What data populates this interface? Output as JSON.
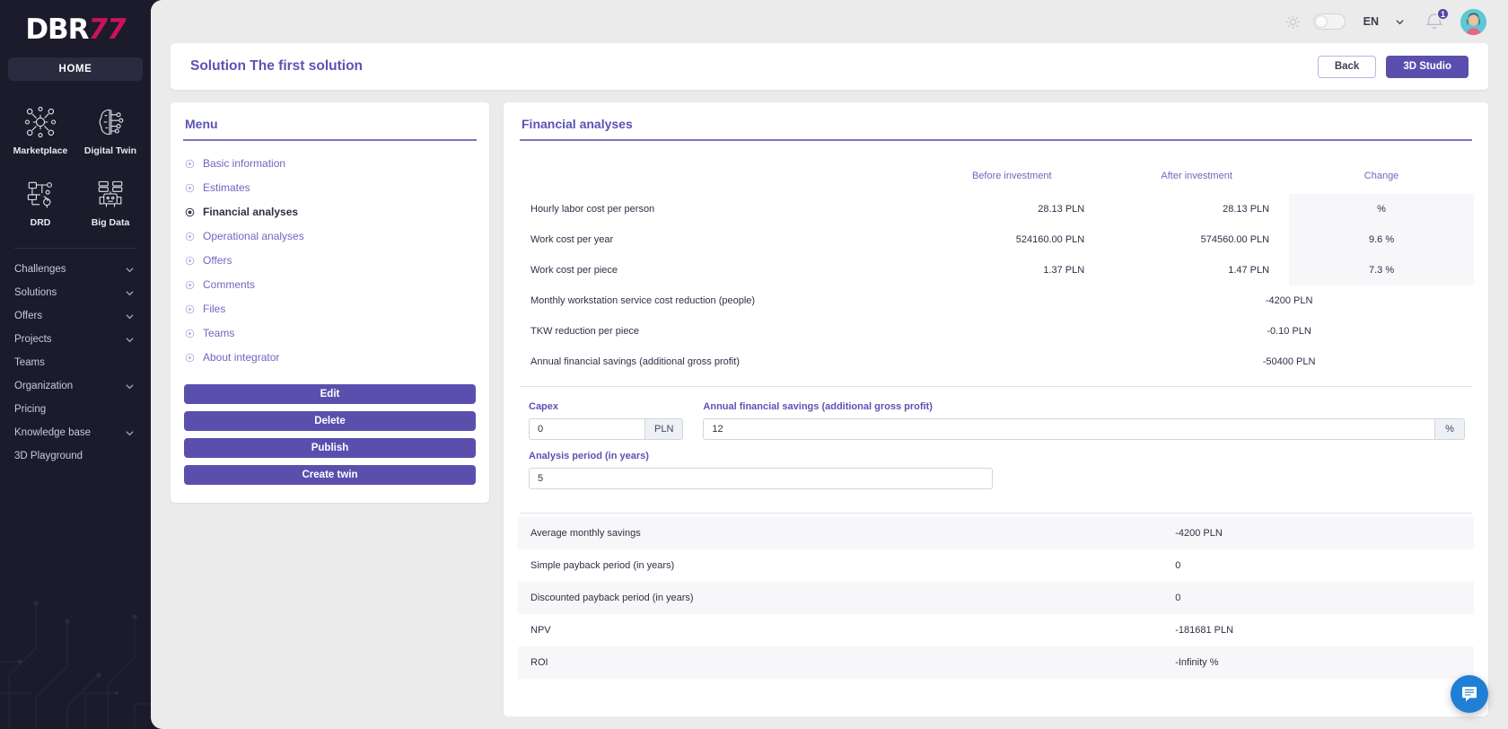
{
  "brand": {
    "logo_white": "DBR",
    "logo_red": "77"
  },
  "sidebar": {
    "home_label": "HOME",
    "tiles": [
      {
        "label": "Marketplace",
        "icon": "marketplace-network-icon"
      },
      {
        "label": "Digital Twin",
        "icon": "brain-circuit-icon"
      },
      {
        "label": "DRD",
        "icon": "drd-flow-icon"
      },
      {
        "label": "Big Data",
        "icon": "big-data-server-icon"
      }
    ],
    "nav": [
      {
        "label": "Challenges",
        "expandable": true
      },
      {
        "label": "Solutions",
        "expandable": true
      },
      {
        "label": "Offers",
        "expandable": true
      },
      {
        "label": "Projects",
        "expandable": true
      },
      {
        "label": "Teams",
        "expandable": false
      },
      {
        "label": "Organization",
        "expandable": true
      },
      {
        "label": "Pricing",
        "expandable": false
      },
      {
        "label": "Knowledge base",
        "expandable": true
      },
      {
        "label": "3D Playground",
        "expandable": false
      }
    ]
  },
  "topbar": {
    "theme_icon": "sun-icon",
    "theme_toggle": "theme-toggle",
    "language": "EN",
    "notifications_count": "1",
    "avatar": "user-avatar"
  },
  "page": {
    "title": "Solution The first solution",
    "back_label": "Back",
    "studio_label": "3D Studio"
  },
  "menu": {
    "title": "Menu",
    "items": [
      {
        "label": "Basic information",
        "active": false
      },
      {
        "label": "Estimates",
        "active": false
      },
      {
        "label": "Financial analyses",
        "active": true
      },
      {
        "label": "Operational analyses",
        "active": false
      },
      {
        "label": "Offers",
        "active": false
      },
      {
        "label": "Comments",
        "active": false
      },
      {
        "label": "Files",
        "active": false
      },
      {
        "label": "Teams",
        "active": false
      },
      {
        "label": "About integrator",
        "active": false
      }
    ],
    "buttons": [
      {
        "label": "Edit"
      },
      {
        "label": "Delete"
      },
      {
        "label": "Publish"
      },
      {
        "label": "Create twin"
      }
    ]
  },
  "financial": {
    "title": "Financial analyses",
    "columns": [
      "",
      "Before investment",
      "After investment",
      "Change"
    ],
    "rows": [
      {
        "label": "Hourly labor cost per person",
        "before": "28.13 PLN",
        "after": "28.13 PLN",
        "change": "%",
        "type": "triple"
      },
      {
        "label": "Work cost per year",
        "before": "524160.00 PLN",
        "after": "574560.00 PLN",
        "change": "9.6 %",
        "type": "triple"
      },
      {
        "label": "Work cost per piece",
        "before": "1.37 PLN",
        "after": "1.47 PLN",
        "change": "7.3 %",
        "type": "triple"
      },
      {
        "label": "Monthly workstation service cost reduction (people)",
        "value": "-4200 PLN",
        "type": "single"
      },
      {
        "label": "TKW reduction per piece",
        "value": "-0.10 PLN",
        "type": "single"
      },
      {
        "label": "Annual financial savings (additional gross profit)",
        "value": "-50400 PLN",
        "type": "single"
      }
    ],
    "inputs": {
      "capex": {
        "label": "Capex",
        "value": "0",
        "suffix": "PLN"
      },
      "savings": {
        "label": "Annual financial savings (additional gross profit)",
        "value": "12",
        "suffix": "%"
      },
      "period": {
        "label": "Analysis period (in years)",
        "value": "5"
      }
    },
    "results": [
      {
        "label": "Average monthly savings",
        "value": "-4200 PLN"
      },
      {
        "label": "Simple payback period (in years)",
        "value": "0"
      },
      {
        "label": "Discounted payback period (in years)",
        "value": "0"
      },
      {
        "label": "NPV",
        "value": "-181681 PLN"
      },
      {
        "label": "ROI",
        "value": "-Infinity %"
      }
    ]
  },
  "chat": {
    "icon": "chat-bubble-icon"
  },
  "colors": {
    "brand_purple": "#5b4fae",
    "accent_red": "#c8145a",
    "sidebar_bg": "#1b1b2c",
    "canvas": "#ebebeb",
    "chat_blue": "#1f7fd4"
  }
}
